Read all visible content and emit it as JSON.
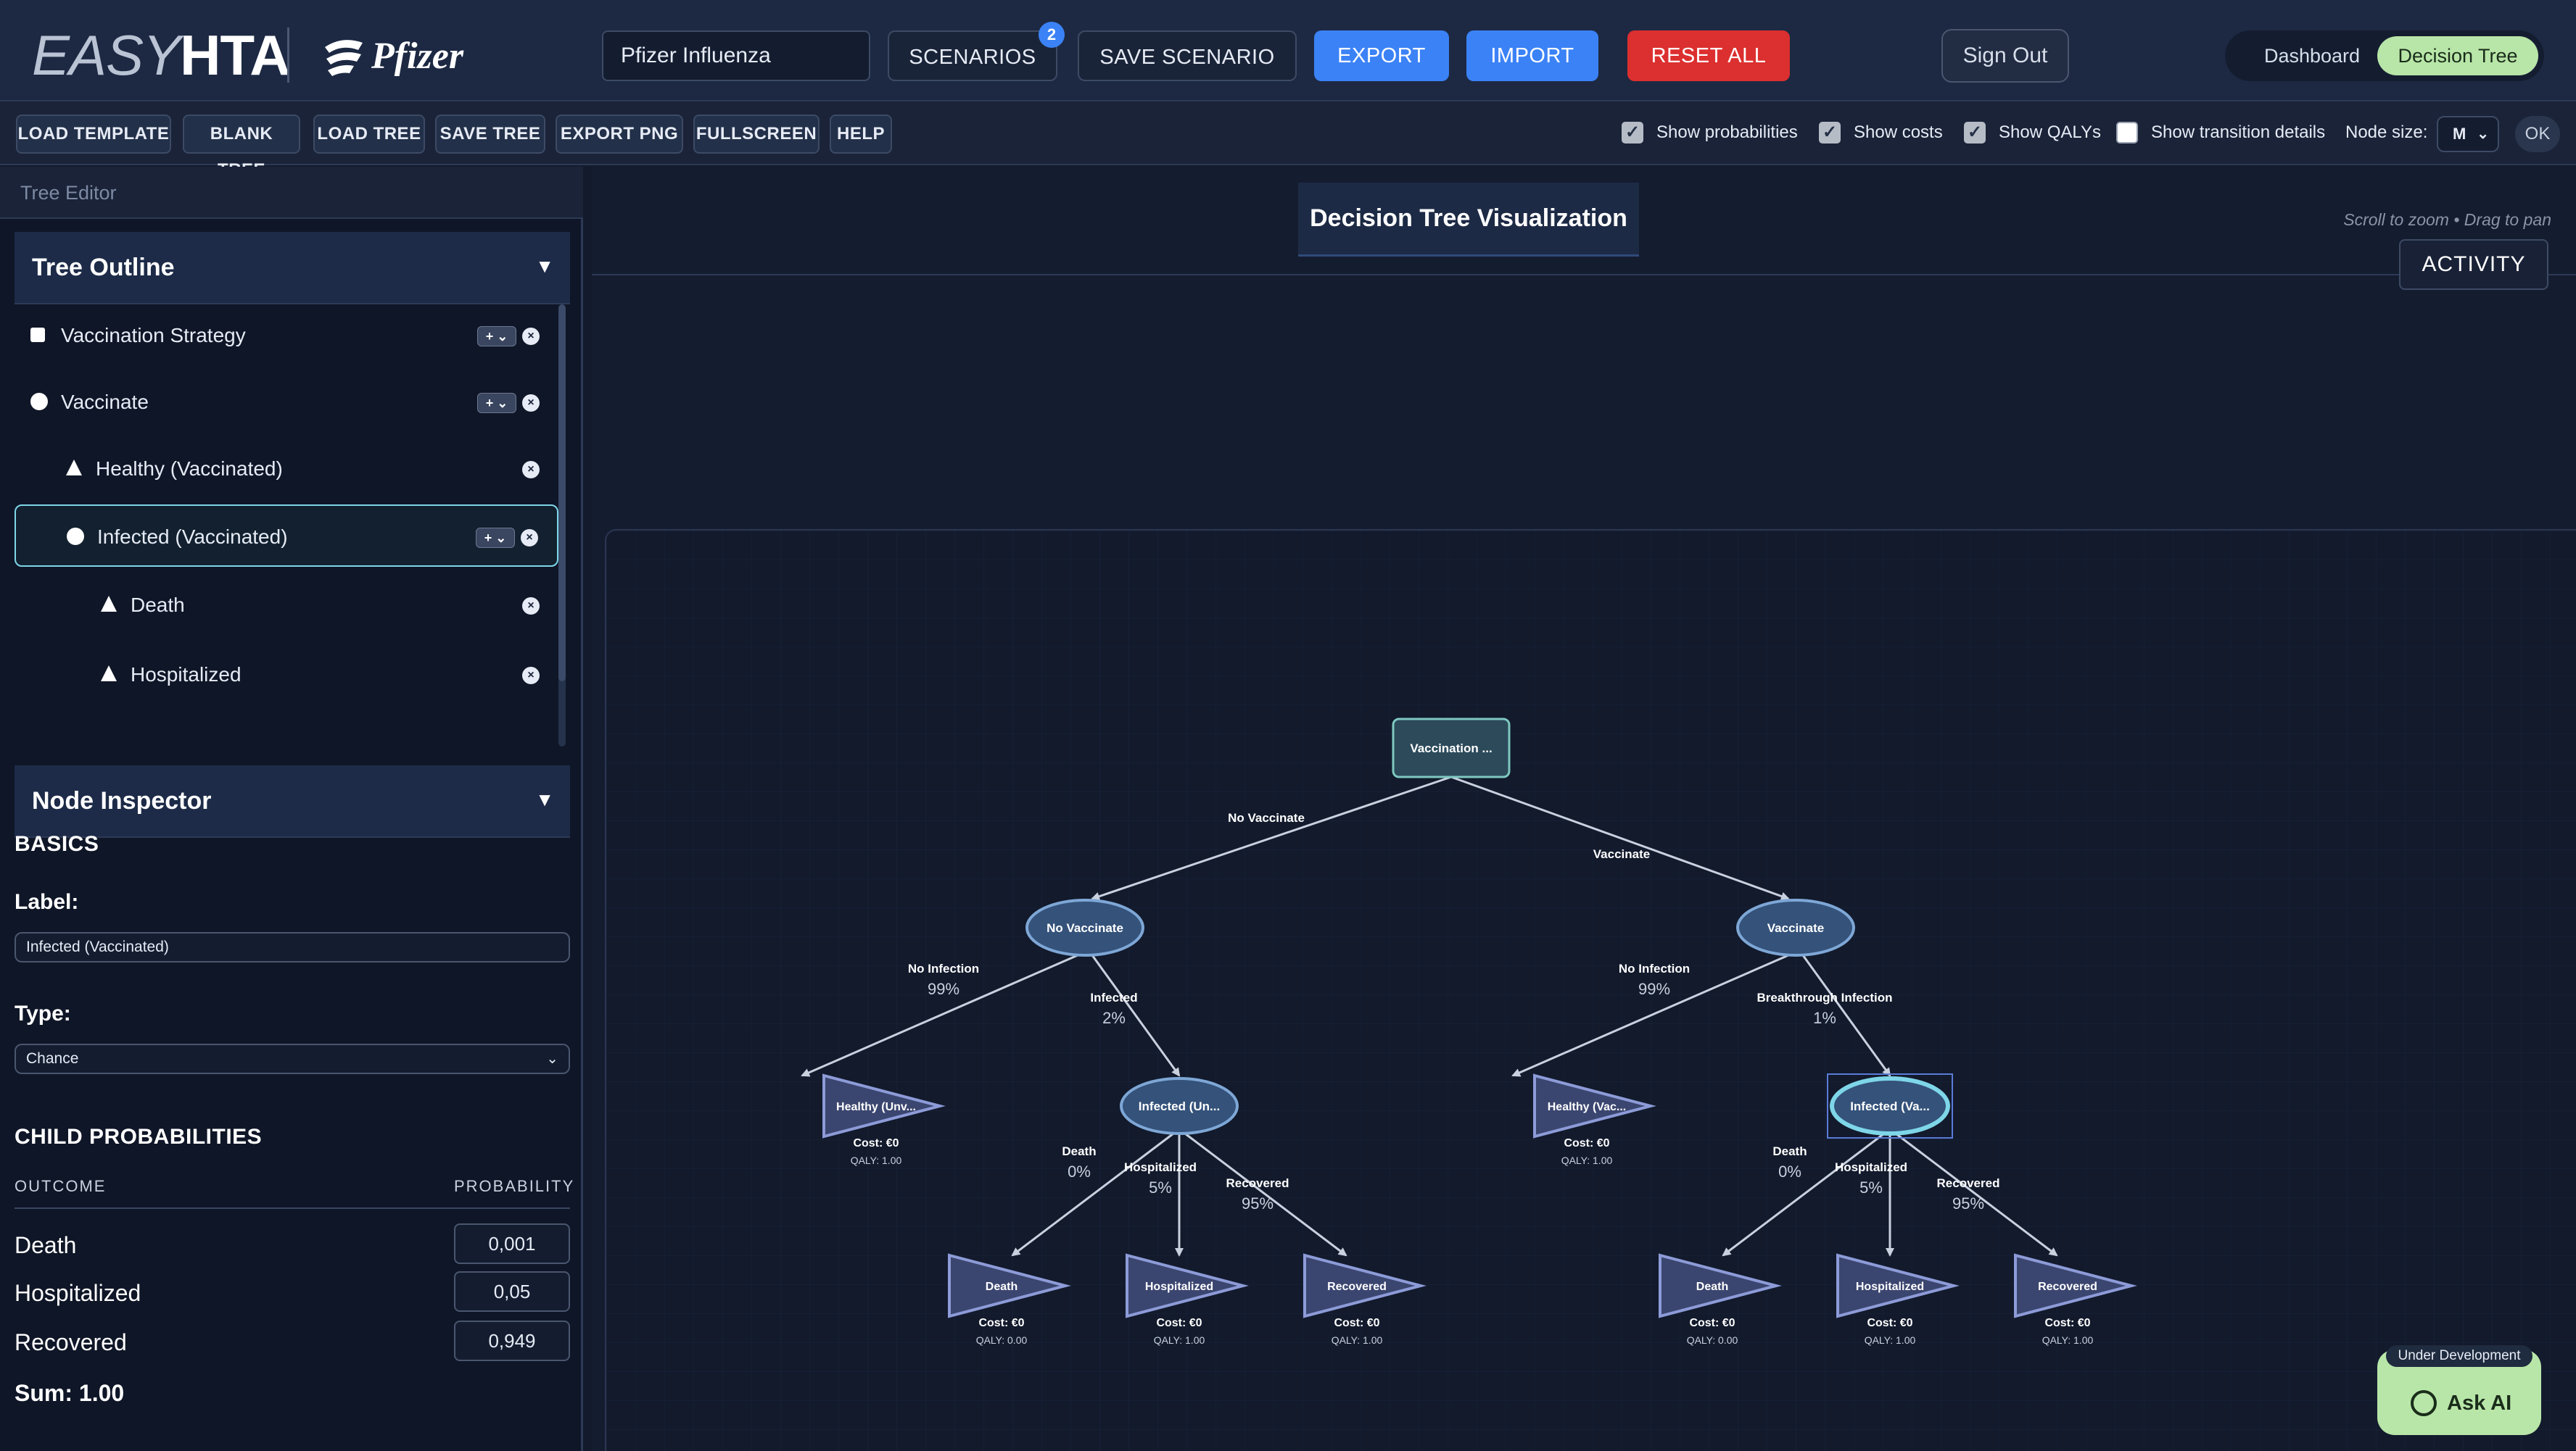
{
  "app": {
    "logo_light": "EASY",
    "logo_bold": "HTA",
    "partner": "Pfizer"
  },
  "header": {
    "project_name": "Pfizer Influenza",
    "scenarios_label": "SCENARIOS",
    "scenarios_count": "2",
    "save_scenario_label": "SAVE SCENARIO",
    "export_label": "EXPORT",
    "import_label": "IMPORT",
    "reset_label": "RESET ALL",
    "signout_label": "Sign Out",
    "view_options": [
      "Dashboard",
      "Decision Tree"
    ],
    "active_view": "Decision Tree"
  },
  "toolbar": {
    "buttons": [
      "LOAD TEMPLATE",
      "BLANK TREE",
      "LOAD TREE",
      "SAVE TREE",
      "EXPORT PNG",
      "FULLSCREEN",
      "HELP"
    ],
    "toggles": [
      {
        "label": "Show probabilities",
        "checked": true
      },
      {
        "label": "Show costs",
        "checked": true
      },
      {
        "label": "Show QALYs",
        "checked": true
      },
      {
        "label": "Show transition details",
        "checked": false
      }
    ],
    "node_size_label": "Node size:",
    "node_size_value": "M",
    "ok_label": "OK"
  },
  "left": {
    "editor_title": "Tree Editor",
    "outline_title": "Tree Outline",
    "outline": [
      {
        "label": "Vaccination Strategy",
        "kind": "decision",
        "indent": 0,
        "addable": true,
        "selected": false
      },
      {
        "label": "Vaccinate",
        "kind": "chance",
        "indent": 0,
        "addable": true,
        "selected": false
      },
      {
        "label": "Healthy (Vaccinated)",
        "kind": "terminal",
        "indent": 1,
        "addable": false,
        "selected": false
      },
      {
        "label": "Infected (Vaccinated)",
        "kind": "chance",
        "indent": 1,
        "addable": true,
        "selected": true
      },
      {
        "label": "Death",
        "kind": "terminal",
        "indent": 2,
        "addable": false,
        "selected": false
      },
      {
        "label": "Hospitalized",
        "kind": "terminal",
        "indent": 2,
        "addable": false,
        "selected": false
      }
    ],
    "inspector_title": "Node Inspector",
    "basics_title": "BASICS",
    "label_title": "Label:",
    "label_value": "Infected (Vaccinated)",
    "type_title": "Type:",
    "type_value": "Chance",
    "child_prob_title": "CHILD PROBABILITIES",
    "col_outcome": "OUTCOME",
    "col_probability": "PROBABILITY",
    "child_probs": [
      {
        "outcome": "Death",
        "probability": "0,001"
      },
      {
        "outcome": "Hospitalized",
        "probability": "0,05"
      },
      {
        "outcome": "Recovered",
        "probability": "0,949"
      }
    ],
    "sum_text": "Sum: 1.00"
  },
  "viz": {
    "title": "Decision Tree Visualization",
    "hint": "Scroll to zoom • Drag to pan",
    "activity_label": "ACTIVITY"
  },
  "tree": {
    "root": {
      "label": "Vaccination ..."
    },
    "branches": [
      {
        "edge_label": "No Vaccinate",
        "node_label": "No Vaccinate",
        "children": [
          {
            "edge_label": "No Infection",
            "prob": "99%",
            "kind": "terminal",
            "node_label": "Healthy (Unv...",
            "cost": "Cost: €0",
            "qaly": "QALY: 1.00"
          },
          {
            "edge_label": "Infected",
            "prob": "2%",
            "kind": "chance",
            "node_label": "Infected (Un...",
            "selected": false,
            "children": [
              {
                "edge_label": "Death",
                "prob": "0%",
                "node_label": "Death",
                "cost": "Cost: €0",
                "qaly": "QALY: 0.00"
              },
              {
                "edge_label": "Hospitalized",
                "prob": "5%",
                "node_label": "Hospitalized",
                "cost": "Cost: €0",
                "qaly": "QALY: 1.00"
              },
              {
                "edge_label": "Recovered",
                "prob": "95%",
                "node_label": "Recovered",
                "cost": "Cost: €0",
                "qaly": "QALY: 1.00"
              }
            ]
          }
        ]
      },
      {
        "edge_label": "Vaccinate",
        "node_label": "Vaccinate",
        "children": [
          {
            "edge_label": "No Infection",
            "prob": "99%",
            "kind": "terminal",
            "node_label": "Healthy (Vac...",
            "cost": "Cost: €0",
            "qaly": "QALY: 1.00"
          },
          {
            "edge_label": "Breakthrough Infection",
            "prob": "1%",
            "kind": "chance",
            "node_label": "Infected (Va...",
            "selected": true,
            "children": [
              {
                "edge_label": "Death",
                "prob": "0%",
                "node_label": "Death",
                "cost": "Cost: €0",
                "qaly": "QALY: 0.00"
              },
              {
                "edge_label": "Hospitalized",
                "prob": "5%",
                "node_label": "Hospitalized",
                "cost": "Cost: €0",
                "qaly": "QALY: 1.00"
              },
              {
                "edge_label": "Recovered",
                "prob": "95%",
                "node_label": "Recovered",
                "cost": "Cost: €0",
                "qaly": "QALY: 1.00"
              }
            ]
          }
        ]
      }
    ]
  },
  "ask_ai": {
    "dev_label": "Under Development",
    "label": "Ask AI"
  },
  "colors": {
    "accent_blue": "#3b82f6",
    "danger_red": "#dc2f2f",
    "active_green": "#b8e6a8",
    "selection_cyan": "#7ed6e8",
    "terminal_fill": "#3b4670",
    "chance_fill": "#34527a"
  }
}
